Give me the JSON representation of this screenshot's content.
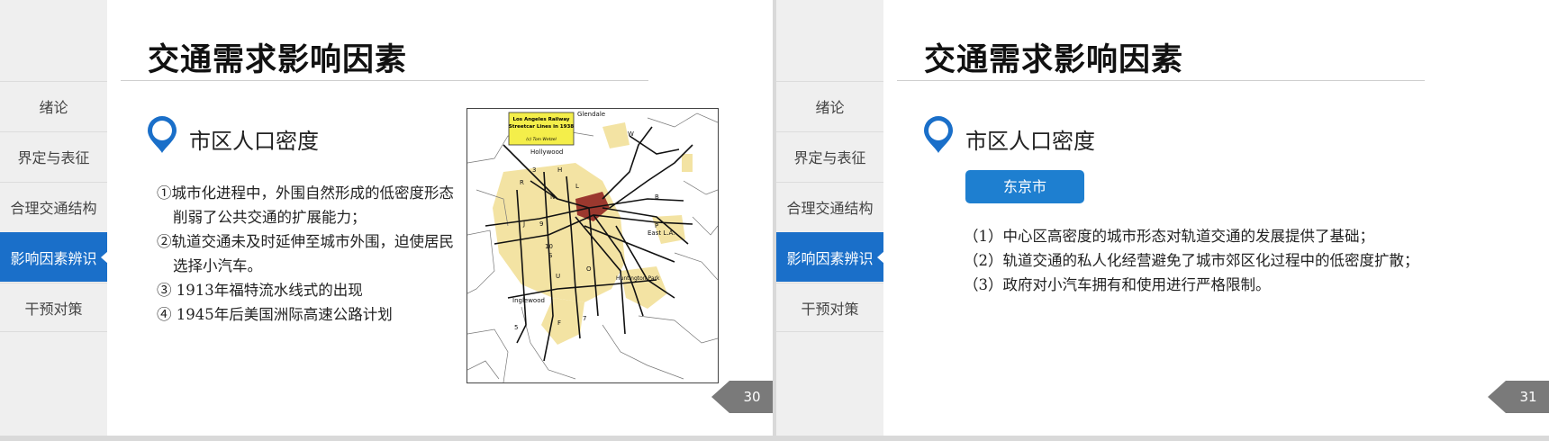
{
  "nav": [
    {
      "label": "绪论"
    },
    {
      "label": "界定与表征"
    },
    {
      "label": "合理交通结构"
    },
    {
      "label": "影响因素辨识"
    },
    {
      "label": "干预对策"
    }
  ],
  "nav_active_index": 3,
  "colors": {
    "accent": "#1a6fc9",
    "tag": "#1e7fd0",
    "page_tab": "#7a7a7a",
    "map_fill": "#f3e3a3",
    "map_core": "#8b1a1a"
  },
  "slides": [
    {
      "title": "交通需求影响因素",
      "subheading": "市区人口密度",
      "bullets": [
        "①城市化进程中，外围自然形成的低密度形态削弱了公共交通的扩展能力；",
        "②轨道交通未及时延伸至城市外围，迫使居民选择小汽车。",
        "③ 1913年福特流水线式的出现",
        "④ 1945年后美国洲际高速公路计划"
      ],
      "map": {
        "title_line1": "Los Angeles Railway",
        "title_line2": "Streetcar Lines in 1938",
        "credit": "(c) Tom Wetzel",
        "labels": [
          "Glendale",
          "Hollywood",
          "East L.A.",
          "Huntington Park",
          "Inglewood",
          "W",
          "R",
          "H",
          "N",
          "P",
          "U",
          "F",
          "B",
          "O",
          "S",
          "J",
          "5",
          "3",
          "7",
          "9",
          "10",
          "L"
        ]
      },
      "page_number": "30"
    },
    {
      "title": "交通需求影响因素",
      "subheading": "市区人口密度",
      "tag": "东京市",
      "points": [
        "（1）中心区高密度的城市形态对轨道交通的发展提供了基础；",
        "（2）轨道交通的私人化经营避免了城市郊区化过程中的低密度扩散；",
        "（3）政府对小汽车拥有和使用进行严格限制。"
      ],
      "page_number": "31"
    }
  ]
}
